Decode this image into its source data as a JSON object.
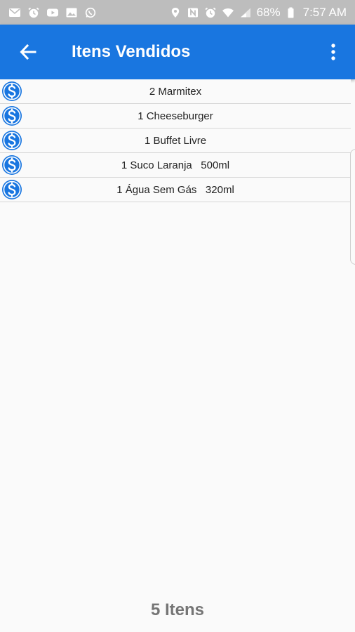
{
  "status_bar": {
    "left_icons": [
      "email-icon",
      "alarm-icon",
      "youtube-icon",
      "gallery-icon",
      "whatsapp-icon"
    ],
    "right_icons": [
      "location-icon",
      "nfc-icon",
      "alarm-icon",
      "wifi-icon",
      "signal-icon",
      "battery-icon"
    ],
    "battery": "68%",
    "time": "7:57 AM"
  },
  "app_bar": {
    "title": "Itens Vendidos",
    "color": "#1976e0"
  },
  "items": [
    {
      "text": "2 Marmitex",
      "icon": "dollar-icon"
    },
    {
      "text": "1 Cheeseburger",
      "icon": "dollar-icon"
    },
    {
      "text": "1 Buffet Livre",
      "icon": "dollar-icon"
    },
    {
      "text": "1 Suco Laranja   500ml",
      "icon": "dollar-icon"
    },
    {
      "text": "1 Água Sem Gás   320ml",
      "icon": "dollar-icon"
    }
  ],
  "footer": {
    "count_label": "5 Itens"
  }
}
